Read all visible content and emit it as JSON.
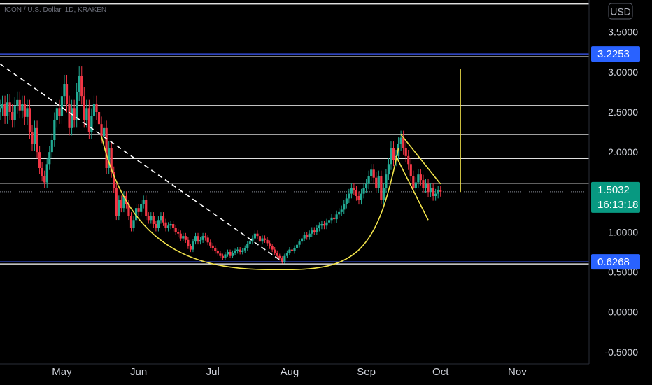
{
  "header": {
    "symbol_line": "ICON / U.S. Dollar, 1D, KRAKEN"
  },
  "currency_button": "USD",
  "colors": {
    "background": "#000000",
    "grid_line": "#ffffff",
    "blue_line": "#3d5afe",
    "badge_blue": "#2962ff",
    "badge_teal": "#089981",
    "candle_up": "#22ab94",
    "candle_down": "#f23645",
    "drawing_yellow": "#f2e34b",
    "trend_dashed": "#ffffff",
    "axis_text": "#d1d4dc"
  },
  "price_badges": [
    {
      "name": "resistance-badge",
      "value": "3.2253",
      "color": "#2962ff"
    },
    {
      "name": "last-price-badge",
      "value": "1.5032",
      "sub": "16:13:18",
      "color": "#089981"
    },
    {
      "name": "support-badge",
      "value": "0.6268",
      "color": "#2962ff"
    }
  ],
  "chart_data": {
    "type": "candlestick",
    "symbol": "ICON / U.S. Dollar, 1D, KRAKEN",
    "y_ticks": [
      "3.5000",
      "3.0000",
      "2.5000",
      "2.0000",
      "1.5000",
      "1.0000",
      "0.5000",
      "0.0000",
      "-0.5000"
    ],
    "y_tick_values": [
      3.5,
      3.0,
      2.5,
      2.0,
      1.5,
      1.0,
      0.5,
      0.0,
      -0.5
    ],
    "x_ticks": [
      "May",
      "Jun",
      "Jul",
      "Aug",
      "Sep",
      "Oct",
      "Nov"
    ],
    "x_tick_dates": [
      "2021-05-01",
      "2021-06-01",
      "2021-07-01",
      "2021-08-01",
      "2021-09-01",
      "2021-10-01",
      "2021-11-01"
    ],
    "ylim": [
      -0.65,
      3.9
    ],
    "xlim": [
      "2021-04-06",
      "2021-11-30"
    ],
    "last_price": 1.5032,
    "last_price_countdown": "16:13:18",
    "horizontal_levels": [
      {
        "price": 3.85,
        "color": "#ffffff",
        "style": "solid"
      },
      {
        "price": 3.2253,
        "color": "#3d5afe",
        "style": "solid"
      },
      {
        "price": 3.19,
        "color": "#ffffff",
        "style": "solid"
      },
      {
        "price": 2.58,
        "color": "#ffffff",
        "style": "solid"
      },
      {
        "price": 2.22,
        "color": "#ffffff",
        "style": "solid"
      },
      {
        "price": 1.92,
        "color": "#ffffff",
        "style": "solid"
      },
      {
        "price": 1.61,
        "color": "#ffffff",
        "style": "solid"
      },
      {
        "price": 0.6268,
        "color": "#3d5afe",
        "style": "solid"
      },
      {
        "price": 0.6,
        "color": "#ffffff",
        "style": "solid"
      }
    ],
    "last_price_line": {
      "price": 1.5032,
      "style": "dotted"
    },
    "candles_daily_close": [
      [
        "2021-04-06",
        2.55
      ],
      [
        "2021-04-07",
        2.6
      ],
      [
        "2021-04-08",
        2.45
      ],
      [
        "2021-04-09",
        2.62
      ],
      [
        "2021-04-10",
        2.5
      ],
      [
        "2021-04-11",
        2.4
      ],
      [
        "2021-04-12",
        2.58
      ],
      [
        "2021-04-13",
        2.65
      ],
      [
        "2021-04-14",
        2.52
      ],
      [
        "2021-04-15",
        2.6
      ],
      [
        "2021-04-16",
        2.44
      ],
      [
        "2021-04-17",
        2.55
      ],
      [
        "2021-04-18",
        2.25
      ],
      [
        "2021-04-19",
        2.1
      ],
      [
        "2021-04-20",
        2.3
      ],
      [
        "2021-04-21",
        2.0
      ],
      [
        "2021-04-22",
        1.8
      ],
      [
        "2021-04-23",
        1.7
      ],
      [
        "2021-04-24",
        1.62
      ],
      [
        "2021-04-25",
        1.85
      ],
      [
        "2021-04-26",
        2.0
      ],
      [
        "2021-04-27",
        2.15
      ],
      [
        "2021-04-28",
        2.4
      ],
      [
        "2021-04-29",
        2.55
      ],
      [
        "2021-04-30",
        2.45
      ],
      [
        "2021-05-01",
        2.7
      ],
      [
        "2021-05-02",
        2.85
      ],
      [
        "2021-05-03",
        2.6
      ],
      [
        "2021-05-04",
        2.3
      ],
      [
        "2021-05-05",
        2.55
      ],
      [
        "2021-05-06",
        2.4
      ],
      [
        "2021-05-07",
        2.75
      ],
      [
        "2021-05-08",
        2.95
      ],
      [
        "2021-05-09",
        2.7
      ],
      [
        "2021-05-10",
        2.4
      ],
      [
        "2021-05-11",
        2.55
      ],
      [
        "2021-05-12",
        2.25
      ],
      [
        "2021-05-13",
        2.45
      ],
      [
        "2021-05-14",
        2.6
      ],
      [
        "2021-05-15",
        2.5
      ],
      [
        "2021-05-16",
        2.35
      ],
      [
        "2021-05-17",
        2.2
      ],
      [
        "2021-05-18",
        2.3
      ],
      [
        "2021-05-19",
        1.8
      ],
      [
        "2021-05-20",
        2.05
      ],
      [
        "2021-05-21",
        1.75
      ],
      [
        "2021-05-22",
        1.55
      ],
      [
        "2021-05-23",
        1.2
      ],
      [
        "2021-05-24",
        1.4
      ],
      [
        "2021-05-25",
        1.3
      ],
      [
        "2021-05-26",
        1.45
      ],
      [
        "2021-05-27",
        1.35
      ],
      [
        "2021-05-28",
        1.2
      ],
      [
        "2021-05-29",
        1.05
      ],
      [
        "2021-05-30",
        1.15
      ],
      [
        "2021-05-31",
        1.3
      ],
      [
        "2021-06-01",
        1.25
      ],
      [
        "2021-06-02",
        1.35
      ],
      [
        "2021-06-03",
        1.4
      ],
      [
        "2021-06-04",
        1.2
      ],
      [
        "2021-06-05",
        1.15
      ],
      [
        "2021-06-06",
        1.2
      ],
      [
        "2021-06-07",
        1.1
      ],
      [
        "2021-06-08",
        1.05
      ],
      [
        "2021-06-09",
        1.15
      ],
      [
        "2021-06-10",
        1.2
      ],
      [
        "2021-06-11",
        1.12
      ],
      [
        "2021-06-12",
        1.05
      ],
      [
        "2021-06-13",
        1.08
      ],
      [
        "2021-06-14",
        1.1
      ],
      [
        "2021-06-15",
        1.05
      ],
      [
        "2021-06-16",
        1.0
      ],
      [
        "2021-06-17",
        0.98
      ],
      [
        "2021-06-18",
        0.92
      ],
      [
        "2021-06-19",
        0.95
      ],
      [
        "2021-06-20",
        0.9
      ],
      [
        "2021-06-21",
        0.82
      ],
      [
        "2021-06-22",
        0.78
      ],
      [
        "2021-06-23",
        0.88
      ],
      [
        "2021-06-24",
        0.95
      ],
      [
        "2021-06-25",
        0.88
      ],
      [
        "2021-06-26",
        0.9
      ],
      [
        "2021-06-27",
        0.95
      ],
      [
        "2021-06-28",
        0.93
      ],
      [
        "2021-06-29",
        0.87
      ],
      [
        "2021-06-30",
        0.83
      ],
      [
        "2021-07-01",
        0.8
      ],
      [
        "2021-07-02",
        0.76
      ],
      [
        "2021-07-03",
        0.73
      ],
      [
        "2021-07-04",
        0.7
      ],
      [
        "2021-07-05",
        0.68
      ],
      [
        "2021-07-06",
        0.72
      ],
      [
        "2021-07-07",
        0.75
      ],
      [
        "2021-07-08",
        0.7
      ],
      [
        "2021-07-09",
        0.74
      ],
      [
        "2021-07-10",
        0.76
      ],
      [
        "2021-07-11",
        0.78
      ],
      [
        "2021-07-12",
        0.75
      ],
      [
        "2021-07-13",
        0.77
      ],
      [
        "2021-07-14",
        0.8
      ],
      [
        "2021-07-15",
        0.85
      ],
      [
        "2021-07-16",
        0.88
      ],
      [
        "2021-07-17",
        0.92
      ],
      [
        "2021-07-18",
        0.98
      ],
      [
        "2021-07-19",
        0.95
      ],
      [
        "2021-07-20",
        0.88
      ],
      [
        "2021-07-21",
        0.92
      ],
      [
        "2021-07-22",
        0.9
      ],
      [
        "2021-07-23",
        0.86
      ],
      [
        "2021-07-24",
        0.82
      ],
      [
        "2021-07-25",
        0.78
      ],
      [
        "2021-07-26",
        0.74
      ],
      [
        "2021-07-27",
        0.7
      ],
      [
        "2021-07-28",
        0.67
      ],
      [
        "2021-07-29",
        0.63
      ],
      [
        "2021-07-30",
        0.7
      ],
      [
        "2021-07-31",
        0.74
      ],
      [
        "2021-08-01",
        0.78
      ],
      [
        "2021-08-02",
        0.76
      ],
      [
        "2021-08-03",
        0.8
      ],
      [
        "2021-08-04",
        0.84
      ],
      [
        "2021-08-05",
        0.88
      ],
      [
        "2021-08-06",
        0.92
      ],
      [
        "2021-08-07",
        0.96
      ],
      [
        "2021-08-08",
        0.94
      ],
      [
        "2021-08-09",
        0.98
      ],
      [
        "2021-08-10",
        1.02
      ],
      [
        "2021-08-11",
        1.0
      ],
      [
        "2021-08-12",
        1.05
      ],
      [
        "2021-08-13",
        1.08
      ],
      [
        "2021-08-14",
        1.1
      ],
      [
        "2021-08-15",
        1.08
      ],
      [
        "2021-08-16",
        1.12
      ],
      [
        "2021-08-17",
        1.15
      ],
      [
        "2021-08-18",
        1.18
      ],
      [
        "2021-08-19",
        1.16
      ],
      [
        "2021-08-20",
        1.22
      ],
      [
        "2021-08-21",
        1.25
      ],
      [
        "2021-08-22",
        1.28
      ],
      [
        "2021-08-23",
        1.35
      ],
      [
        "2021-08-24",
        1.42
      ],
      [
        "2021-08-25",
        1.48
      ],
      [
        "2021-08-26",
        1.55
      ],
      [
        "2021-08-27",
        1.52
      ],
      [
        "2021-08-28",
        1.45
      ],
      [
        "2021-08-29",
        1.4
      ],
      [
        "2021-08-30",
        1.48
      ],
      [
        "2021-08-31",
        1.55
      ],
      [
        "2021-09-01",
        1.6
      ],
      [
        "2021-09-02",
        1.7
      ],
      [
        "2021-09-03",
        1.78
      ],
      [
        "2021-09-04",
        1.68
      ],
      [
        "2021-09-05",
        1.55
      ],
      [
        "2021-09-06",
        1.7
      ],
      [
        "2021-09-07",
        1.4
      ],
      [
        "2021-09-08",
        1.55
      ],
      [
        "2021-09-09",
        1.72
      ],
      [
        "2021-09-10",
        1.85
      ],
      [
        "2021-09-11",
        2.05
      ],
      [
        "2021-09-12",
        1.9
      ],
      [
        "2021-09-13",
        1.95
      ],
      [
        "2021-09-14",
        2.1
      ],
      [
        "2021-09-15",
        2.18
      ],
      [
        "2021-09-16",
        2.05
      ],
      [
        "2021-09-17",
        1.95
      ],
      [
        "2021-09-18",
        1.85
      ],
      [
        "2021-09-19",
        1.7
      ],
      [
        "2021-09-20",
        1.55
      ],
      [
        "2021-09-21",
        1.62
      ],
      [
        "2021-09-22",
        1.72
      ],
      [
        "2021-09-23",
        1.65
      ],
      [
        "2021-09-24",
        1.55
      ],
      [
        "2021-09-25",
        1.6
      ],
      [
        "2021-09-26",
        1.5
      ],
      [
        "2021-09-27",
        1.55
      ],
      [
        "2021-09-28",
        1.45
      ],
      [
        "2021-09-29",
        1.48
      ],
      [
        "2021-09-30",
        1.52
      ],
      [
        "2021-10-01",
        1.5032
      ]
    ],
    "drawings": [
      {
        "name": "descending-trendline",
        "style": "dashed",
        "color": "#ffffff",
        "points": [
          [
            "2021-04-06",
            3.1
          ],
          [
            "2021-07-29",
            0.63
          ]
        ]
      },
      {
        "name": "cup-curve",
        "style": "solid",
        "color": "#f2e34b",
        "points": [
          [
            "2021-05-17",
            2.2
          ],
          [
            "2021-06-18",
            0.95
          ],
          [
            "2021-07-28",
            0.53
          ],
          [
            "2021-08-23",
            0.95
          ],
          [
            "2021-09-14",
            2.05
          ]
        ]
      },
      {
        "name": "handle-line-upper",
        "style": "solid",
        "color": "#f2e34b",
        "points": [
          [
            "2021-09-15",
            2.22
          ],
          [
            "2021-10-01",
            1.6
          ]
        ]
      },
      {
        "name": "handle-line-lower",
        "style": "solid",
        "color": "#f2e34b",
        "points": [
          [
            "2021-09-13",
            1.95
          ],
          [
            "2021-09-26",
            1.15
          ]
        ]
      },
      {
        "name": "target-projection-line",
        "style": "solid",
        "color": "#f2e34b",
        "points": [
          [
            "2021-10-09",
            1.5
          ],
          [
            "2021-10-09",
            3.04
          ]
        ]
      }
    ]
  }
}
